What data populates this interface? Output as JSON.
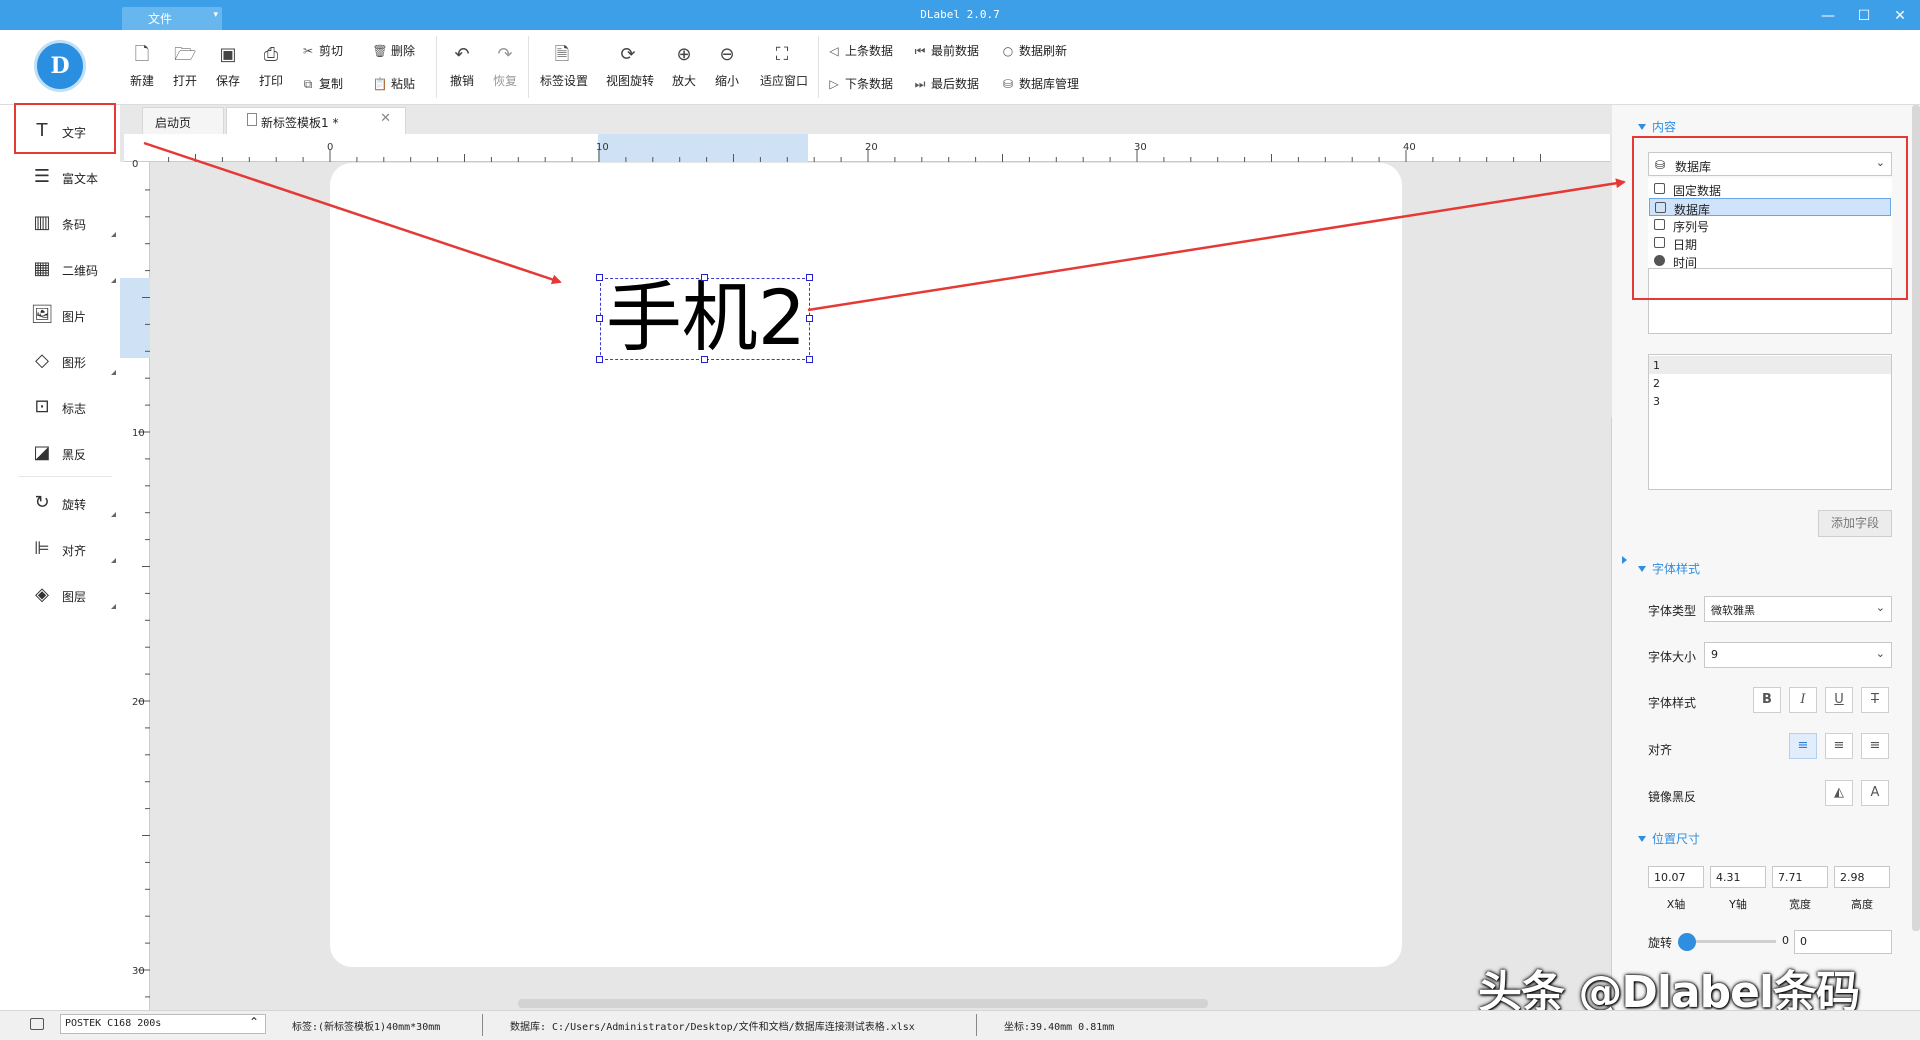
{
  "window": {
    "title": "DLabel 2.0.7",
    "file_menu": "文件",
    "controls": {
      "minimize": "—",
      "maximize": "☐",
      "close": "✕"
    }
  },
  "toolbar": {
    "new": "新建",
    "open": "打开",
    "save": "保存",
    "print": "打印",
    "cut": "剪切",
    "copy": "复制",
    "delete": "删除",
    "paste": "粘贴",
    "undo": "撤销",
    "redo": "恢复",
    "label_settings": "标签设置",
    "view_rotate": "视图旋转",
    "zoom_in": "放大",
    "zoom_out": "缩小",
    "fit_window": "适应窗口",
    "prev_record": "上条数据",
    "next_record": "下条数据",
    "first_record": "最前数据",
    "last_record": "最后数据",
    "refresh_data": "数据刷新",
    "db_manage": "数据库管理"
  },
  "left_tools": [
    {
      "label": "文字",
      "icon": "text-icon"
    },
    {
      "label": "富文本",
      "icon": "rich-text-icon"
    },
    {
      "label": "条码",
      "icon": "barcode-icon"
    },
    {
      "label": "二维码",
      "icon": "qrcode-icon"
    },
    {
      "label": "图片",
      "icon": "image-icon"
    },
    {
      "label": "图形",
      "icon": "shape-icon"
    },
    {
      "label": "标志",
      "icon": "logo-icon"
    },
    {
      "label": "黑反",
      "icon": "invert-icon"
    },
    {
      "label": "旋转",
      "icon": "rotate-icon"
    },
    {
      "label": "对齐",
      "icon": "align-icon"
    },
    {
      "label": "图层",
      "icon": "layers-icon"
    }
  ],
  "tabs": {
    "home": "启动页",
    "document": "新标签模板1 *",
    "close": "✕"
  },
  "ruler": {
    "h_labels": [
      "0",
      "10",
      "20",
      "30",
      "40"
    ],
    "v_labels": [
      "0",
      "10",
      "20",
      "30"
    ]
  },
  "canvas": {
    "text_object": "手机2"
  },
  "right_panel": {
    "content_header": "内容",
    "content_selected": "数据库",
    "content_options": [
      "固定数据",
      "数据库",
      "序列号",
      "日期",
      "时间"
    ],
    "content_options_selected_index": 1,
    "fields": [
      "1",
      "2",
      "3"
    ],
    "add_field": "添加字段",
    "font_header": "字体样式",
    "font_type_label": "字体类型",
    "font_type_value": "微软雅黑",
    "font_size_label": "字体大小",
    "font_size_value": "9",
    "font_style_label": "字体样式",
    "font_style_buttons": [
      "B",
      "I",
      "U",
      "T"
    ],
    "align_label": "对齐",
    "mirror_label": "镜像黑反",
    "position_header": "位置尺寸",
    "x_value": "10.07",
    "y_value": "4.31",
    "width_value": "7.71",
    "height_value": "2.98",
    "x_label": "X轴",
    "y_label": "Y轴",
    "width_label": "宽度",
    "height_label": "高度",
    "rotate_label": "旋转",
    "rotate_slider_value": "0",
    "rotate_input_value": "0"
  },
  "watermark": "头条 @Dlabel条码",
  "status_bar": {
    "printer": "POSTEK C168 200s",
    "label_info": "标签:(新标签模板1)40mm*30mm",
    "database_info": "数据库: C:/Users/Administrator/Desktop/文件和文档/数据库连接测试表格.xlsx",
    "coords": "坐标:39.40mm 0.81mm"
  },
  "colors": {
    "title_bar": "#3c9fe8",
    "accent": "#2f8ee0",
    "annotation_red": "#e53935"
  }
}
